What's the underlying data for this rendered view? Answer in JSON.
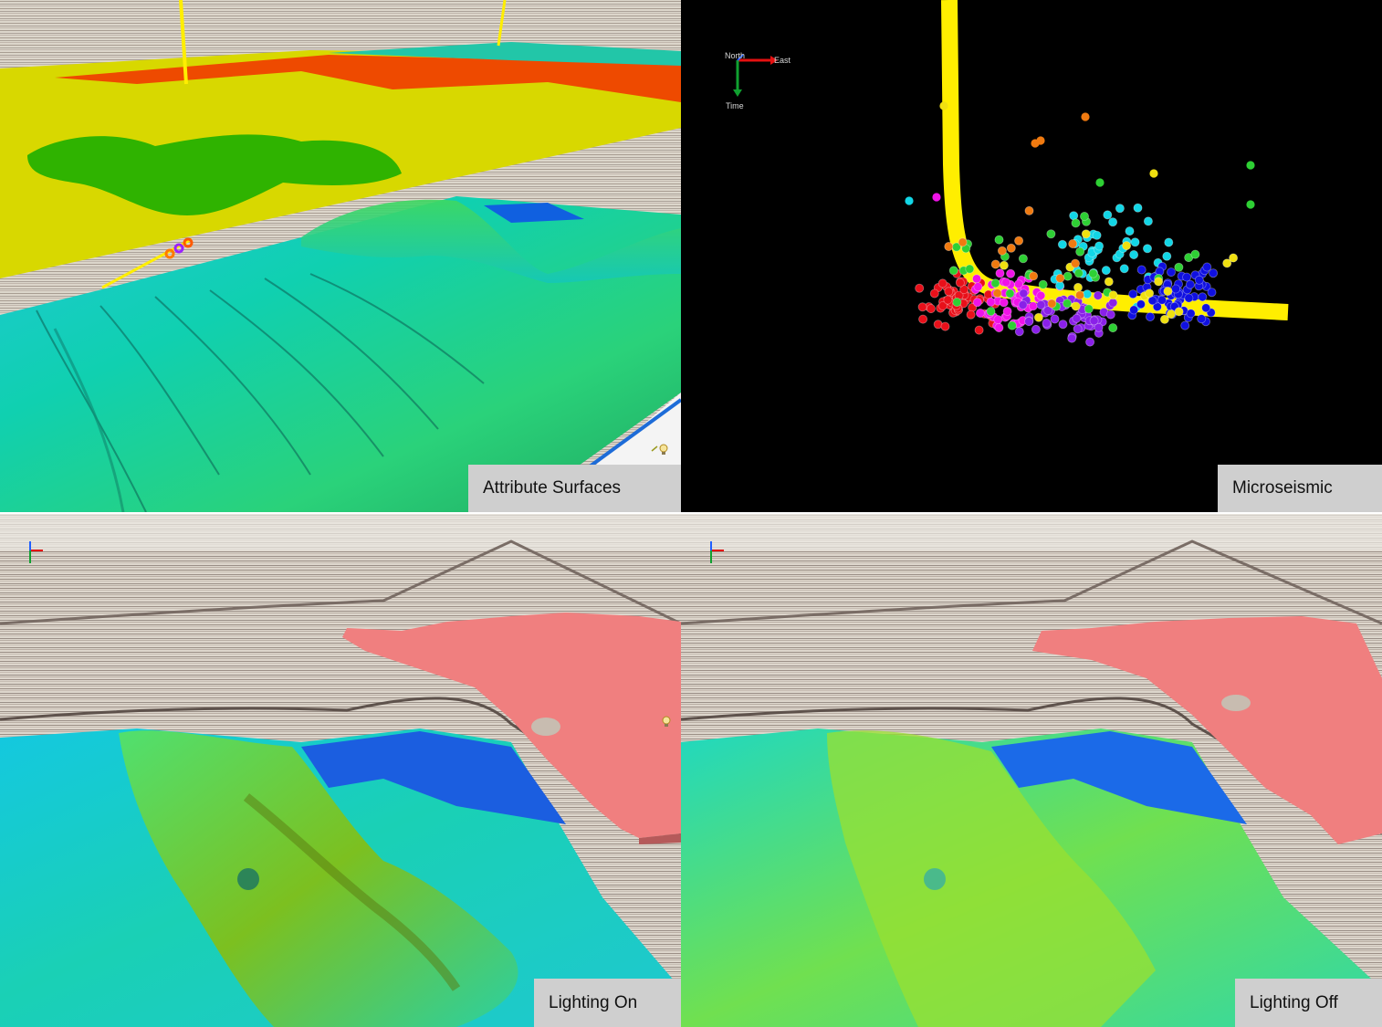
{
  "panels": {
    "attribute": {
      "caption": "Attribute Surfaces"
    },
    "micro": {
      "caption": "Microseismic",
      "axes": {
        "north": "North",
        "east": "East",
        "time": "Time"
      }
    },
    "lightOn": {
      "caption": "Lighting On"
    },
    "lightOff": {
      "caption": "Lighting Off"
    }
  },
  "colors": {
    "seismic_bg": "#d9d2c6",
    "surface_yellow": "#d8d800",
    "surface_orange": "#ee4a00",
    "surface_green": "#2fb300",
    "horizon_cyan": "#20d8d0",
    "basin_blue": "#1060e0",
    "salt_pink": "#f07f7f",
    "well_yellow": "#ffee00",
    "micro_bg": "#000000"
  },
  "icons": [
    "lightbulb-icon",
    "axis-triad-icon"
  ]
}
